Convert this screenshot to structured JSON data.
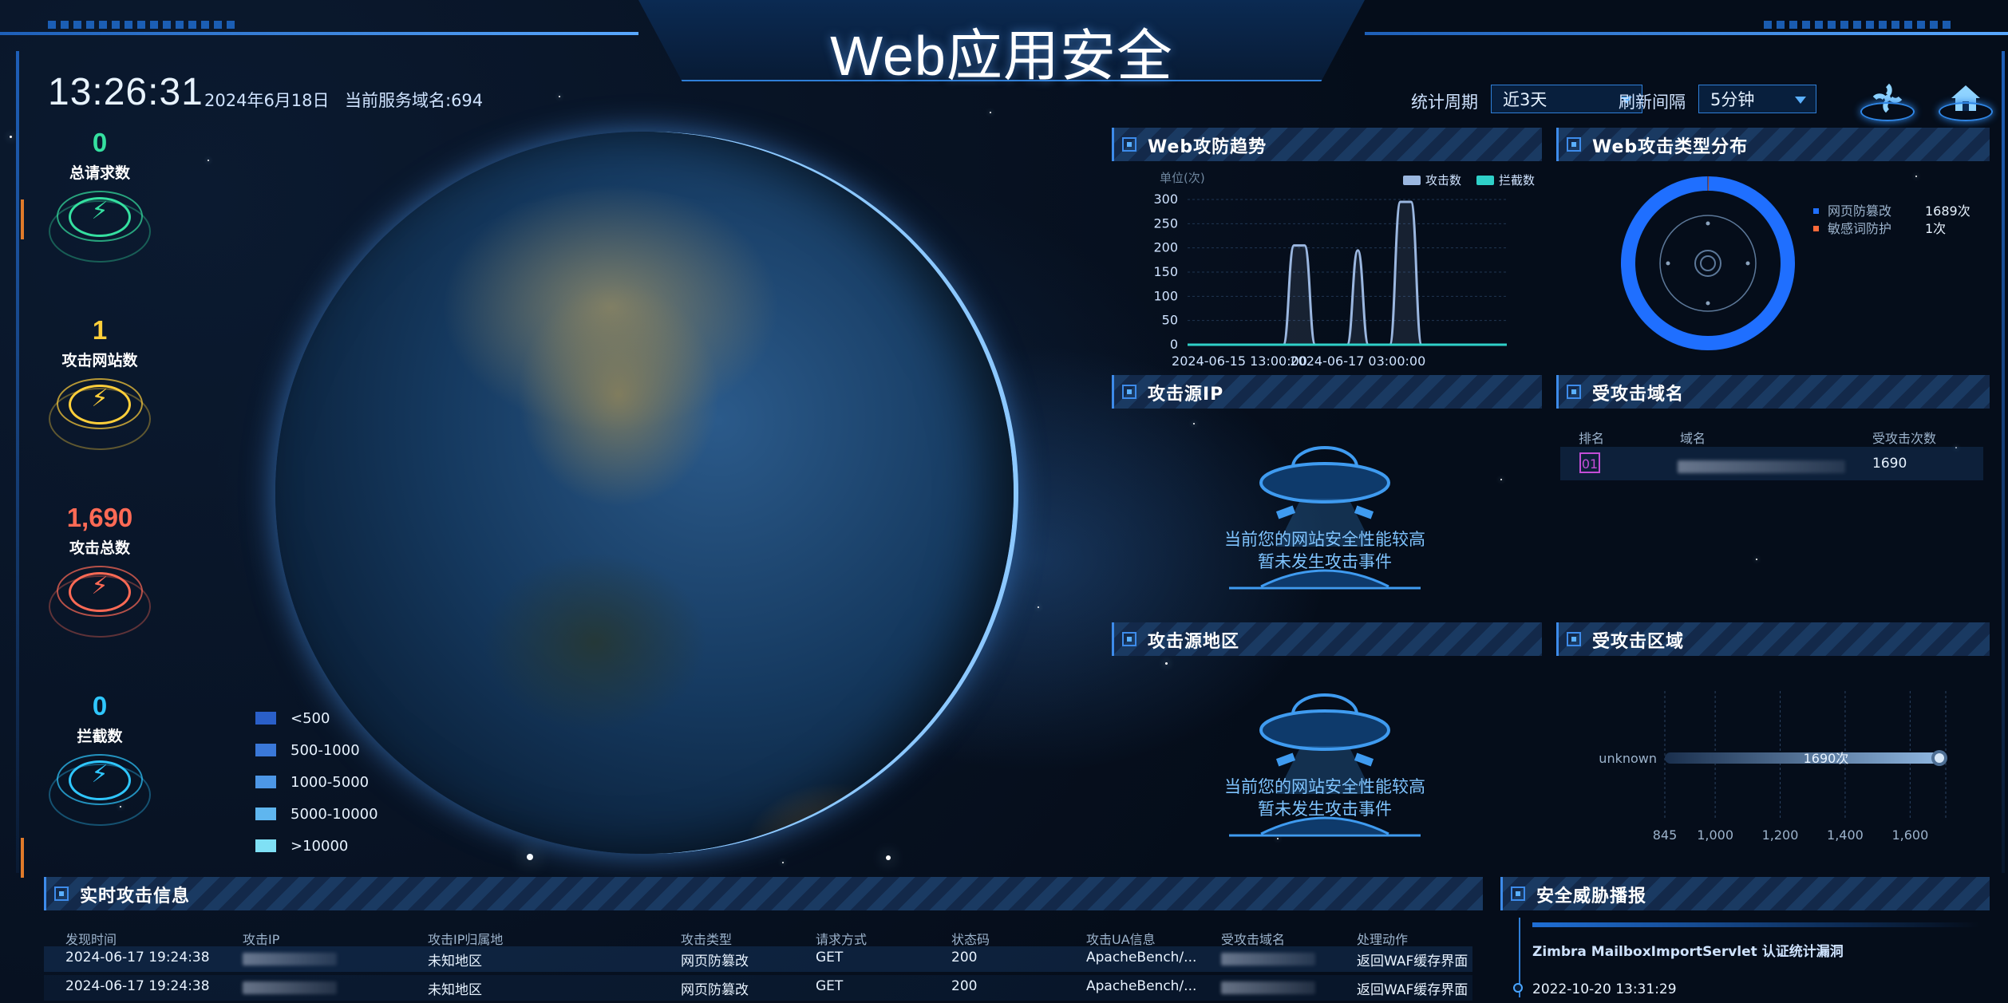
{
  "title": "Web应用安全",
  "clock": "13:26:31",
  "date": "2024年6月18日",
  "domain_count": "当前服务域名:694",
  "controls": {
    "period_label": "统计周期",
    "period_value": "近3天",
    "refresh_label": "刷新间隔",
    "refresh_value": "5分钟"
  },
  "stats": [
    {
      "value": "0",
      "label": "总请求数",
      "color": "#35e0a0"
    },
    {
      "value": "1",
      "label": "攻击网站数",
      "color": "#ffcf3a"
    },
    {
      "value": "1,690",
      "label": "攻击总数",
      "color": "#ff6a55"
    },
    {
      "value": "0",
      "label": "拦截数",
      "color": "#2fc7ff"
    }
  ],
  "map_legend": [
    {
      "label": "<500",
      "color": "#2a5fc8"
    },
    {
      "label": "500-1000",
      "color": "#3a78d8"
    },
    {
      "label": "1000-5000",
      "color": "#4d97e6"
    },
    {
      "label": "5000-10000",
      "color": "#5fb6ef"
    },
    {
      "label": ">10000",
      "color": "#7fe0f5"
    }
  ],
  "panels": {
    "trend": "Web攻防趋势",
    "types": "Web攻击类型分布",
    "source_ip": "攻击源IP",
    "domains": "受攻击域名",
    "source_region": "攻击源地区",
    "region": "受攻击区域",
    "realtime": "实时攻击信息",
    "threat": "安全威胁播报"
  },
  "empty_state": {
    "line1": "当前您的网站安全性能较高",
    "line2": "暂未发生攻击事件"
  },
  "chart_data": [
    {
      "type": "area",
      "ylabel": "单位(次)",
      "ylim": [
        0,
        300
      ],
      "yticks": [
        "0",
        "50",
        "100",
        "150",
        "200",
        "250",
        "300"
      ],
      "xticks": [
        "2024-06-15 13:00:00",
        "2024-06-17 03:00:00"
      ],
      "legend": [
        "攻击数",
        "拦截数"
      ],
      "x": [
        0,
        9,
        10,
        11,
        12,
        13,
        14,
        15,
        16,
        17,
        18,
        19,
        20,
        21,
        22,
        23,
        24,
        30
      ],
      "series": [
        {
          "name": "攻击数",
          "values": [
            0,
            0,
            205,
            205,
            0,
            0,
            0,
            0,
            195,
            0,
            0,
            0,
            295,
            295,
            0,
            0,
            0,
            0
          ]
        },
        {
          "name": "拦截数",
          "values": [
            0,
            0,
            0,
            0,
            0,
            0,
            0,
            0,
            0,
            0,
            0,
            0,
            0,
            0,
            0,
            0,
            0,
            0
          ]
        }
      ]
    },
    {
      "type": "pie",
      "categories": [
        "网页防篡改",
        "敏感词防护"
      ],
      "values": [
        1689,
        1
      ],
      "labels": [
        "1689次",
        "1次"
      ],
      "colors": [
        "#1f6fff",
        "#ff6a3a"
      ]
    },
    {
      "type": "bar",
      "orientation": "horizontal",
      "categories": [
        "unknown"
      ],
      "values": [
        1690
      ],
      "data_labels": [
        "1690次"
      ],
      "xlim": [
        845,
        1690
      ],
      "xticks": [
        "845",
        "1,000",
        "1,200",
        "1,400",
        "1,600"
      ]
    }
  ],
  "domains_table": {
    "headers": [
      "排名",
      "域名",
      "受攻击次数"
    ],
    "rows": [
      {
        "rank": "01",
        "count": "1690"
      }
    ]
  },
  "attack_table": {
    "headers": [
      "发现时间",
      "攻击IP",
      "攻击IP归属地",
      "攻击类型",
      "请求方式",
      "状态码",
      "攻击UA信息",
      "受攻击域名",
      "处理动作"
    ],
    "rows": [
      {
        "time": "2024-06-17 19:24:38",
        "region": "未知地区",
        "type": "网页防篡改",
        "method": "GET",
        "status": "200",
        "ua": "ApacheBench/...",
        "action": "返回WAF缓存界面"
      },
      {
        "time": "2024-06-17 19:24:38",
        "region": "未知地区",
        "type": "网页防篡改",
        "method": "GET",
        "status": "200",
        "ua": "ApacheBench/...",
        "action": "返回WAF缓存界面"
      }
    ]
  },
  "threat": {
    "item_title": "Zimbra MailboxImportServlet 认证统计漏洞",
    "item_date": "2022-10-20 13:31:29"
  }
}
